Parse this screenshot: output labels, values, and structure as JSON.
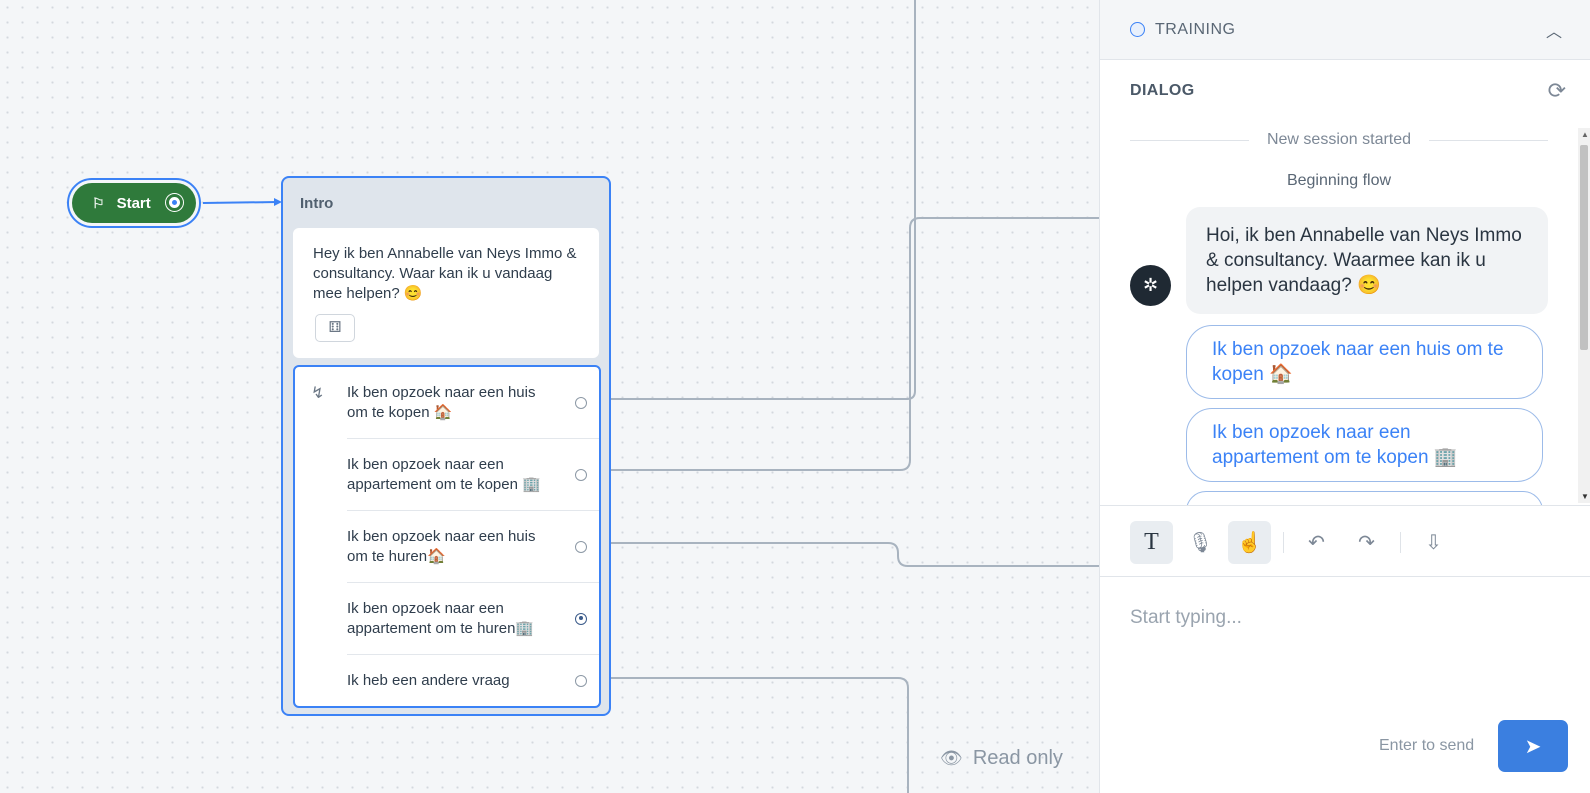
{
  "canvas": {
    "start_node": {
      "label": "Start",
      "icon": "flag-icon"
    },
    "intro_block": {
      "title": "Intro",
      "message": "Hey ik ben Annabelle van Neys Immo & consultancy. Waar kan ik u vandaag mee helpen? 😊",
      "choices": [
        {
          "label": "Ik ben opzoek naar een huis om te kopen 🏠"
        },
        {
          "label": "Ik ben opzoek naar een appartement om te kopen 🏢"
        },
        {
          "label": "Ik ben opzoek naar een huis om te huren🏠"
        },
        {
          "label": "Ik ben opzoek naar een appartement om te huren🏢"
        },
        {
          "label": "Ik heb een andere vraag"
        }
      ]
    },
    "read_only_label": "Read only"
  },
  "panel": {
    "training_label": "TRAINING",
    "dialog_title": "DIALOG",
    "session_separator": "New session started",
    "beginning_flow": "Beginning flow",
    "bot_message": "Hoi, ik ben Annabelle van Neys Immo & consultancy. Waarmee kan ik u helpen vandaag? 😊",
    "quick_replies": [
      {
        "label": "Ik ben opzoek naar een huis om te kopen 🏠"
      },
      {
        "label": "Ik ben opzoek naar een appartement om te kopen 🏢"
      }
    ],
    "composer_placeholder": "Start typing...",
    "enter_hint": "Enter to send"
  },
  "colors": {
    "accent": "#3b82f6",
    "start_green": "#2f7a3b",
    "send_button": "#3b7fe0"
  }
}
